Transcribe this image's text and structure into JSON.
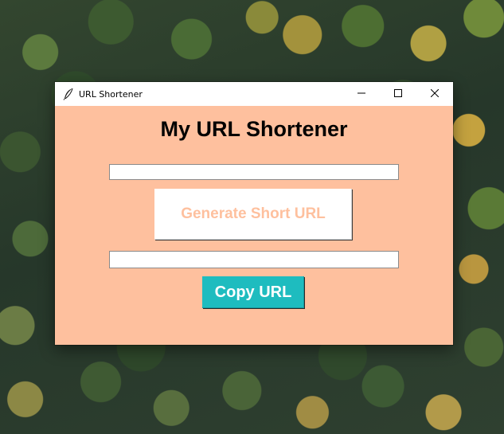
{
  "window": {
    "title": "URL Shortener",
    "controls": {
      "minimize": "minimize-icon",
      "maximize": "maximize-icon",
      "close": "close-icon"
    },
    "app_icon": "feather-icon"
  },
  "main": {
    "heading": "My URL Shortener",
    "long_url_input": {
      "value": "",
      "placeholder": ""
    },
    "generate_button": {
      "label": "Generate Short URL"
    },
    "short_url_output": {
      "value": "",
      "placeholder": ""
    },
    "copy_button": {
      "label": "Copy URL"
    }
  },
  "colors": {
    "window_background": "#fec09e",
    "generate_button_background": "#ffffff",
    "generate_button_text": "#fec09e",
    "copy_button_background": "#1ebcbf",
    "copy_button_text": "#ffffff"
  }
}
